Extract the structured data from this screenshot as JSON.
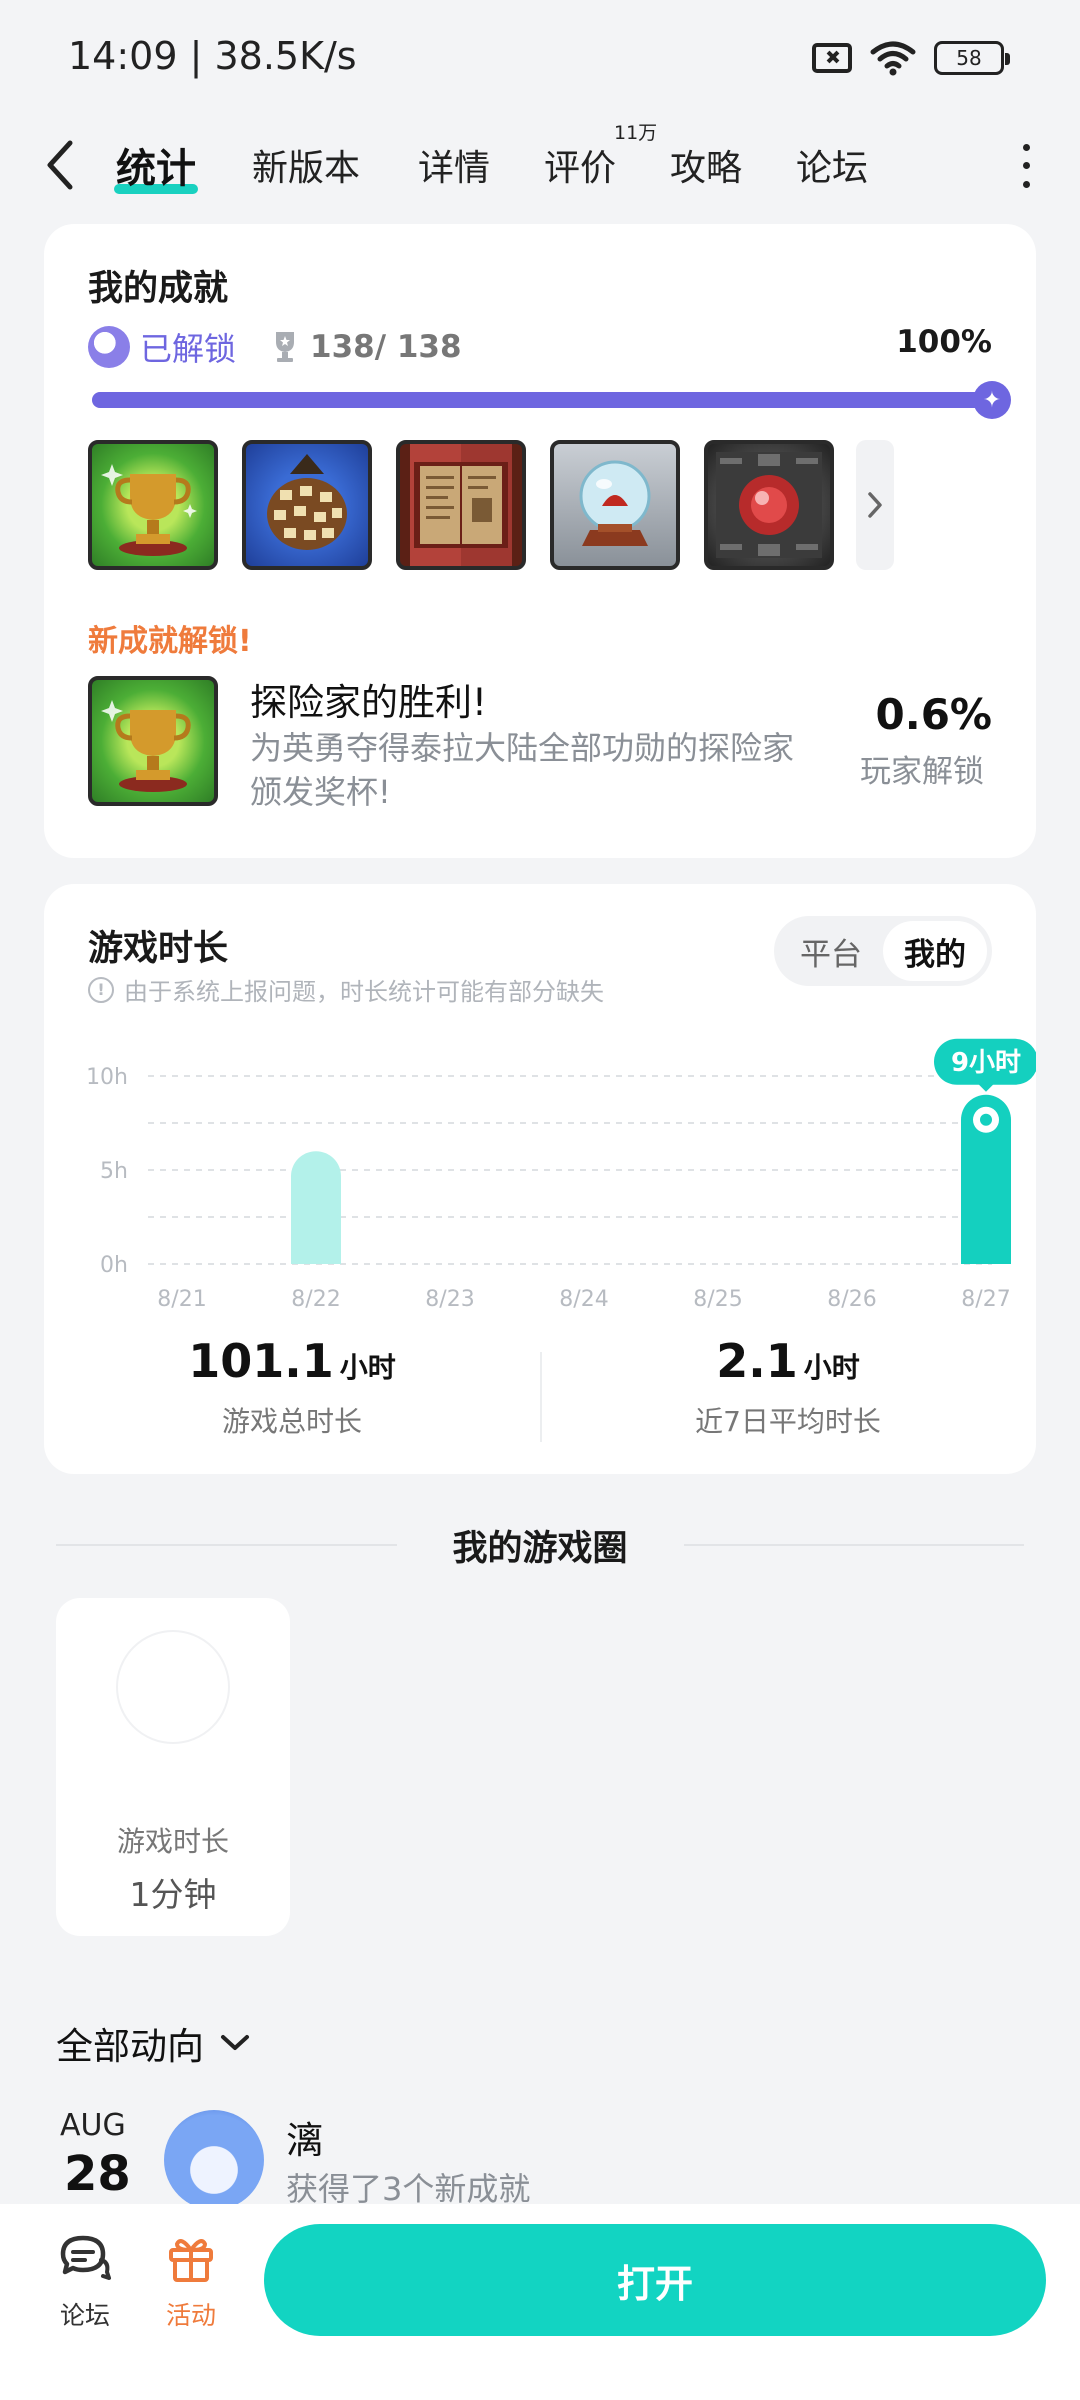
{
  "status": {
    "time_speed": "14:09 | 38.5K/s",
    "battery": "58"
  },
  "nav": {
    "tabs": [
      {
        "label": "统计",
        "active": true
      },
      {
        "label": "新版本"
      },
      {
        "label": "详情"
      },
      {
        "label": "评价",
        "badge": "11万"
      },
      {
        "label": "攻略"
      },
      {
        "label": "论坛"
      }
    ]
  },
  "achievements": {
    "title": "我的成就",
    "unlocked_label": "已解锁",
    "count": "138/ 138",
    "percent": "100%",
    "progress_fraction": 1.0,
    "badges": [
      "trophy-badge",
      "treasure-bag-badge",
      "book-badge",
      "crystal-ball-badge",
      "red-gem-badge"
    ],
    "new_label": "新成就解锁!",
    "new_title": "探险家的胜利!",
    "new_desc": "为英勇夺得泰拉大陆全部功勋的探险家颁发奖杯!",
    "new_pct": "0.6%",
    "new_pct_label": "玩家解锁"
  },
  "playtime": {
    "title": "游戏时长",
    "notice": "由于系统上报问题，时长统计可能有部分缺失",
    "toggle": [
      "平台",
      "我的"
    ],
    "toggle_selected": "我的",
    "total_value": "101.1",
    "total_unit": "小时",
    "total_label": "游戏总时长",
    "avg_value": "2.1",
    "avg_unit": "小时",
    "avg_label": "近7日平均时长"
  },
  "chart_data": {
    "type": "bar",
    "categories": [
      "8/21",
      "8/22",
      "8/23",
      "8/24",
      "8/25",
      "8/26",
      "8/27"
    ],
    "values": [
      0,
      6,
      0,
      0,
      0,
      0,
      9
    ],
    "ylim": [
      0,
      10
    ],
    "yticks": [
      "0h",
      "5h",
      "10h"
    ],
    "highlight_index": 6,
    "highlight_label": "9小时",
    "colors": {
      "normal": "#b3f1ea",
      "highlight": "#14d0bf",
      "grid": "#dfe2e5"
    }
  },
  "circle": {
    "title": "我的游戏圈",
    "card_label": "游戏时长",
    "card_value": "1分钟"
  },
  "feed": {
    "header": "全部动向",
    "month": "AUG",
    "day": "28",
    "user": "漓",
    "text": "获得了3个新成就"
  },
  "bottom": {
    "forum_label": "论坛",
    "activity_label": "活动",
    "open_label": "打开",
    "accent": "#12d4c2",
    "activity_color": "#ef7b3c"
  }
}
